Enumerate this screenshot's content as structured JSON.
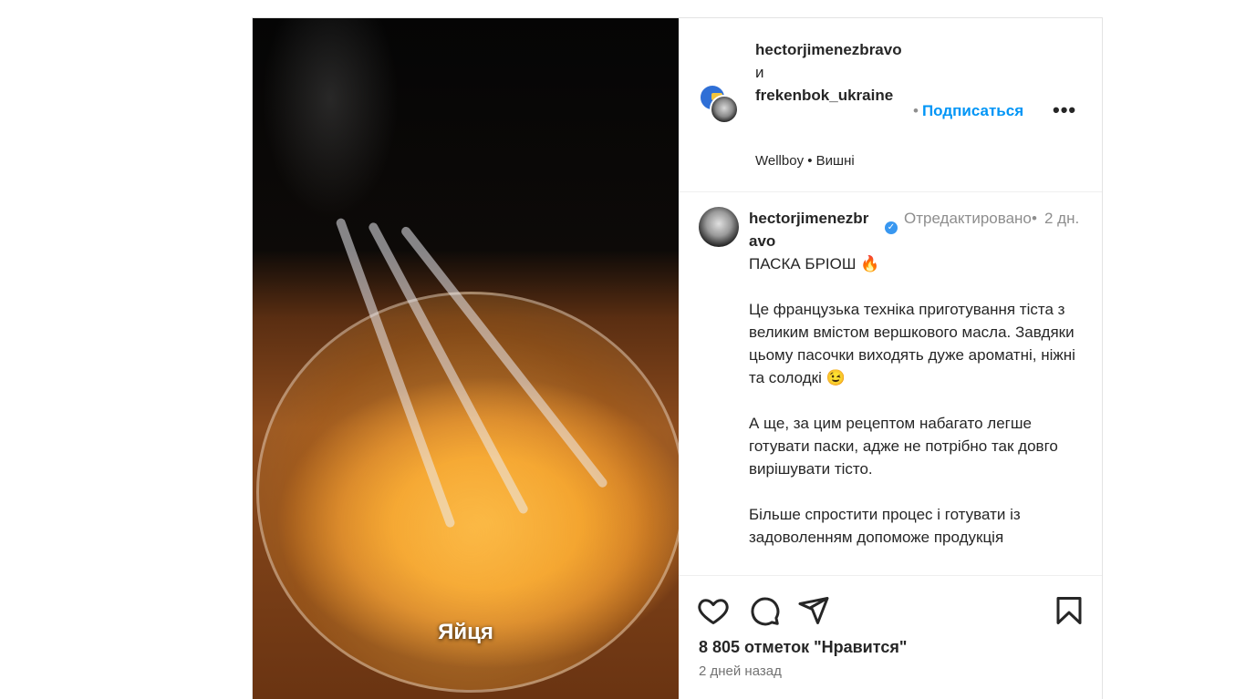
{
  "media": {
    "caption": "Яйця"
  },
  "header": {
    "user1": "hectorjimenezbravo",
    "and": "и",
    "user2": "frekenbok_ukraine",
    "audio": "Wellboy • Вишні",
    "follow_dot": "•",
    "follow": "Подписаться",
    "more": "•••"
  },
  "comment": {
    "username": "hectorjimenezbravo",
    "edited": "Отредактировано",
    "dot": "•",
    "time": "2 дн.",
    "title": "ПАСКА БРІОШ 🔥",
    "p1": "Це французька техніка приготування тіста з великим вмістом вершкового масла. Завдяки цьому пасочки виходять дуже ароматні, ніжні та солодкі 😉",
    "p2": "А ще, за цим рецептом набагато легше готувати паски, адже не потрібно так довго вирішувати тісто.",
    "p3": "Більше спростити процес і готувати із задоволенням допоможе продукція"
  },
  "footer": {
    "likes": "8 805 отметок \"Нравится\"",
    "date": "2 дней назад"
  },
  "icons": {
    "like": "heart-icon",
    "comment": "comment-icon",
    "share": "send-icon",
    "save": "bookmark-icon"
  },
  "colors": {
    "accent": "#0095f6",
    "verified": "#3897f0",
    "muted": "#8e8e8e"
  }
}
